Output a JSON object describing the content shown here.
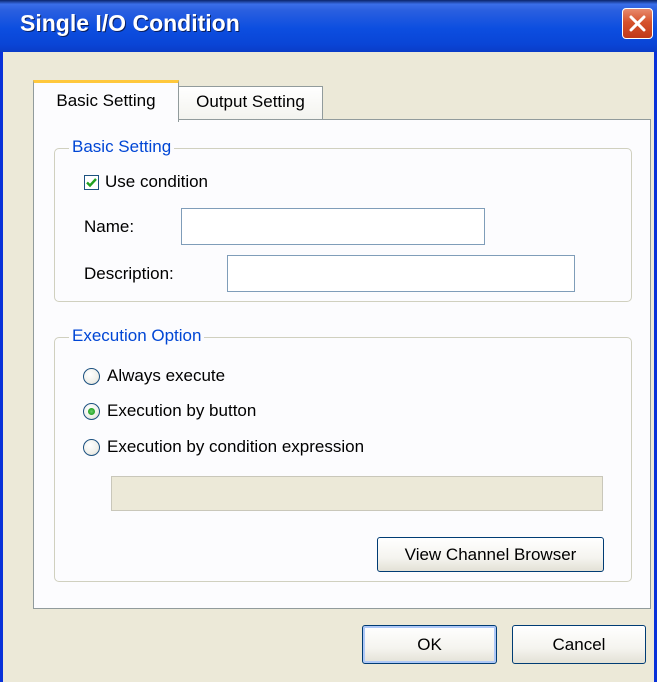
{
  "window": {
    "title": "Single I/O Condition"
  },
  "tabs": [
    {
      "label": "Basic Setting",
      "active": true
    },
    {
      "label": "Output Setting",
      "active": false
    }
  ],
  "basic_group": {
    "title": "Basic Setting",
    "use_condition_label": "Use condition",
    "use_condition_checked": true,
    "name_label": "Name:",
    "name_value": "",
    "description_label": "Description:",
    "description_value": ""
  },
  "execution_group": {
    "title": "Execution Option",
    "options": [
      {
        "label": "Always execute",
        "selected": false
      },
      {
        "label": "Execution by button",
        "selected": true
      },
      {
        "label": "Execution by condition expression",
        "selected": false
      }
    ],
    "expression_value": "",
    "view_channel_browser_label": "View Channel Browser"
  },
  "footer": {
    "ok_label": "OK",
    "cancel_label": "Cancel"
  },
  "colors": {
    "title_bar": "#0a45d6",
    "group_title": "#0046d5",
    "dialog_bg": "#ece9d8",
    "tab_highlight": "#ffc83c",
    "check_mark": "#21a121"
  }
}
